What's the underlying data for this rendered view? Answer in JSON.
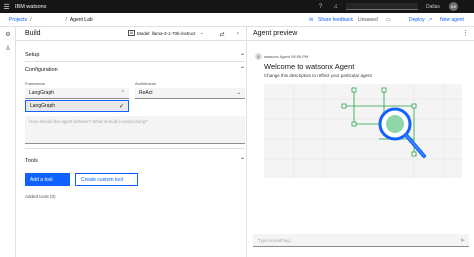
{
  "topbar": {
    "brand": "IBM watsonx",
    "region": "Dallas",
    "avatar_initials": "AS",
    "icons": [
      "menu-icon",
      "help-icon",
      "notification-icon",
      "region-icon"
    ]
  },
  "breadcrumb": {
    "items": [
      "Projects",
      "/",
      "",
      "/",
      "Agent Lab"
    ]
  },
  "subbar": {
    "share_feedback": "Share feedback",
    "status": "Unsaved",
    "deploy": "Deploy",
    "new_agent": "New agent"
  },
  "build": {
    "title": "Build",
    "model_label": "Model: llama-3-1-70b-instruct",
    "sections": {
      "setup": "Setup",
      "configuration": "Configuration",
      "tools": "Tools"
    },
    "framework": {
      "label": "Framework",
      "value": "LangGraph",
      "option_selected": "LangGraph"
    },
    "architecture": {
      "label": "Architecture",
      "value": "ReAct"
    },
    "instructions_placeholder": "How should the agent behave? What should it avoid doing?",
    "add_tool": "Add a tool",
    "create_tool": "Create custom tool",
    "tools_added": "Added tools (0)"
  },
  "preview": {
    "title": "Agent preview",
    "msg_meta": "watsonx Agent 08:06 PM",
    "welcome": "Welcome to watsonx Agent",
    "description": "Change this description to reflect your particular agent",
    "input_placeholder": "Type something..."
  },
  "colors": {
    "accent": "#0f62fe",
    "topbar": "#161616",
    "illustration_green": "#24a148",
    "illustration_blue": "#0f62fe"
  }
}
